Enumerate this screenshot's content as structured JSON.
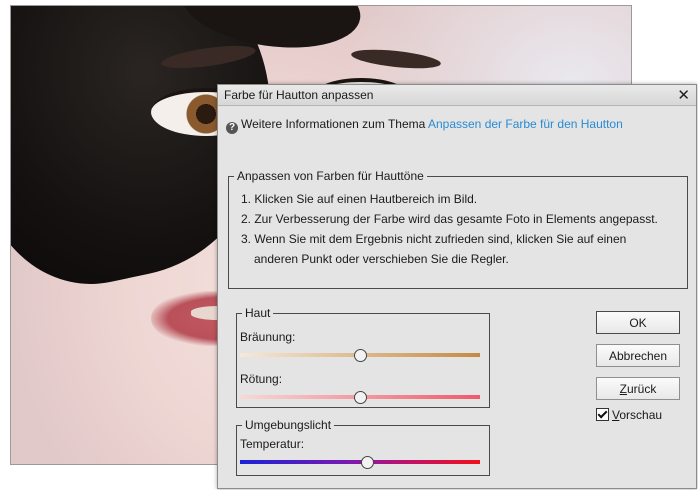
{
  "dialog": {
    "title": "Farbe für Hautton anpassen",
    "close_glyph": "✕",
    "help_glyph": "?",
    "info_text": "Weitere Informationen zum Thema",
    "info_link": "Anpassen der Farbe für den Hautton",
    "instructions": {
      "legend": "Anpassen von Farben für Hauttöne",
      "step1": "1. Klicken Sie auf einen Hautbereich im Bild.",
      "step2": "2. Zur Verbesserung der Farbe wird das gesamte Foto in Elements angepasst.",
      "step3a": "3. Wenn Sie mit dem Ergebnis nicht zufrieden sind, klicken Sie auf einen",
      "step3b": "anderen Punkt oder verschieben Sie die Regler."
    },
    "haut": {
      "legend": "Haut",
      "braeunung_label": "Bräunung:",
      "braeunung_value": 0.5,
      "roetung_label": "Rötung:",
      "roetung_value": 0.5
    },
    "umgebungslicht": {
      "legend": "Umgebungslicht",
      "temperatur_label": "Temperatur:",
      "temperatur_value": 0.53
    },
    "buttons": {
      "ok": "OK",
      "abbrechen": "Abbrechen",
      "zurueck_first": "Z",
      "zurueck_rest": "urück"
    },
    "preview": {
      "first": "V",
      "rest": "orschau",
      "checked": true
    }
  },
  "colors": {
    "link": "#2a8ad4",
    "braeunung_track": [
      "#f6e9d8",
      "#c48a44"
    ],
    "roetung_track": [
      "#f6d9d6",
      "#ee5a6a"
    ],
    "temperatur_track": [
      "#1a22d8",
      "#f0101a"
    ]
  }
}
